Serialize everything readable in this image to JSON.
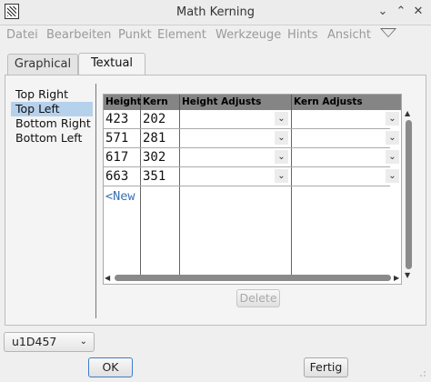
{
  "window": {
    "title": "Math Kerning",
    "controls": {
      "minimize": "⌄",
      "maximize": "⌃",
      "close": "✕"
    }
  },
  "menu": [
    "Datei",
    "Bearbeiten",
    "Punkt",
    "Element",
    "Werkzeuge",
    "Hints",
    "Ansicht"
  ],
  "tabs": [
    {
      "label": "Graphical",
      "active": false
    },
    {
      "label": "Textual",
      "active": true
    }
  ],
  "corners": [
    "Top Right",
    "Top Left",
    "Bottom Right",
    "Bottom Left"
  ],
  "selected_corner": "Top Left",
  "table": {
    "headers": [
      "Height",
      "Kern",
      "Height Adjusts",
      "Kern Adjusts"
    ],
    "rows": [
      {
        "height": "423",
        "kern": "202"
      },
      {
        "height": "571",
        "kern": "281"
      },
      {
        "height": "617",
        "kern": "302"
      },
      {
        "height": "663",
        "kern": "351"
      }
    ],
    "new_row": "<New"
  },
  "buttons": {
    "delete": "Delete",
    "ok": "OK",
    "cancel": "Fertig"
  },
  "glyph_selector": {
    "value": "u1D457"
  },
  "colors": {
    "selection": "#b6d1ec",
    "header": "#858585",
    "new_row": "#3a6fb3",
    "focus": "#3e7dc4"
  }
}
